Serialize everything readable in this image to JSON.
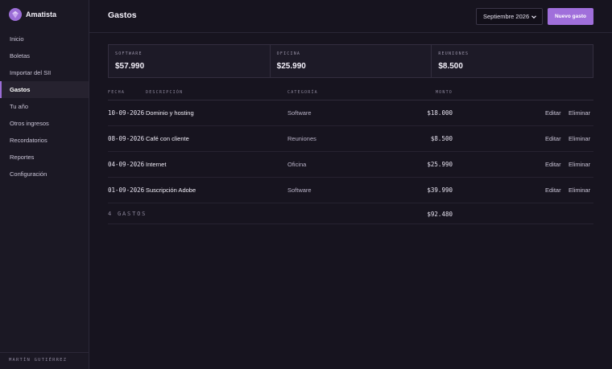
{
  "app": {
    "name": "Amatista",
    "accent": "#9b6dd6"
  },
  "sidebar": {
    "items": [
      {
        "label": "Inicio"
      },
      {
        "label": "Boletas"
      },
      {
        "label": "Importar del SII"
      },
      {
        "label": "Gastos",
        "active": true
      },
      {
        "label": "Tu año"
      },
      {
        "label": "Otros ingresos"
      },
      {
        "label": "Recordatorios"
      },
      {
        "label": "Reportes"
      },
      {
        "label": "Configuración"
      }
    ],
    "user": "MARTÍN GUTIÉRREZ"
  },
  "header": {
    "title": "Gastos",
    "month_select": "Septiembre 2026",
    "add_button": "Nuevo gasto"
  },
  "summary": [
    {
      "label": "SOFTWARE",
      "value": "$57.990"
    },
    {
      "label": "OFICINA",
      "value": "$25.990"
    },
    {
      "label": "REUNIONES",
      "value": "$8.500"
    }
  ],
  "table": {
    "columns": {
      "date": "FECHA",
      "description": "DESCRIPCIÓN",
      "category": "CATEGORÍA",
      "amount": "MONTO"
    },
    "rows": [
      {
        "date": "10-09-2026",
        "description": "Dominio y hosting",
        "category": "Software",
        "amount": "$18.000",
        "edit": "Editar",
        "delete": "Eliminar"
      },
      {
        "date": "08-09-2026",
        "description": "Café con cliente",
        "category": "Reuniones",
        "amount": "$8.500",
        "edit": "Editar",
        "delete": "Eliminar"
      },
      {
        "date": "04-09-2026",
        "description": "Internet",
        "category": "Oficina",
        "amount": "$25.990",
        "edit": "Editar",
        "delete": "Eliminar"
      },
      {
        "date": "01-09-2026",
        "description": "Suscripción Adobe",
        "category": "Software",
        "amount": "$39.990",
        "edit": "Editar",
        "delete": "Eliminar"
      }
    ],
    "total_label": "4 GASTOS",
    "total_amount": "$92.480"
  }
}
